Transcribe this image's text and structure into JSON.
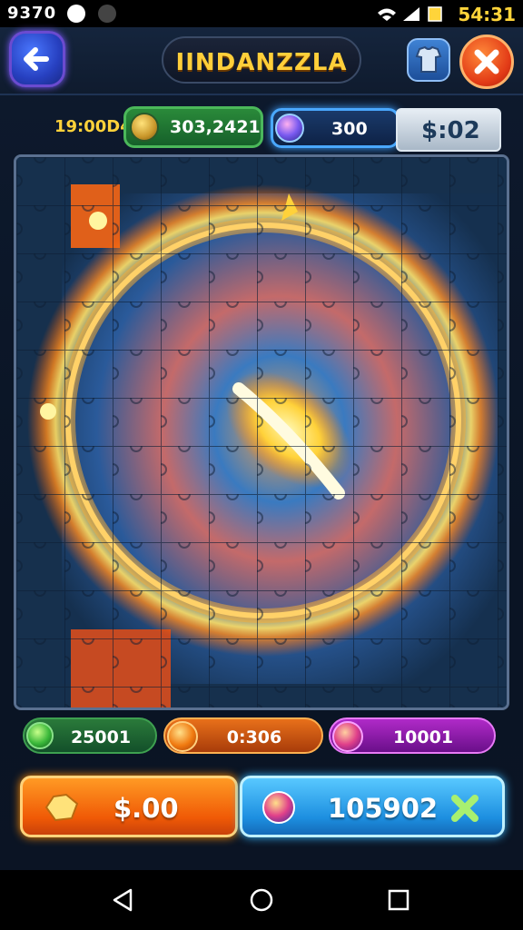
{
  "status_bar": {
    "left_text": "9370",
    "time": "54:31",
    "icons": [
      "wifi-icon",
      "signal-icon",
      "battery-icon"
    ]
  },
  "header": {
    "title": "IINDANZZLA",
    "back_icon": "arrow-left-icon",
    "shirt_icon": "shirt-icon",
    "close_icon": "close-icon"
  },
  "stats": {
    "time_label": "19:00D4",
    "coins": "303,2421",
    "gems": "300",
    "money": "$:02"
  },
  "counters": [
    {
      "icon": "green-gem-icon",
      "value": "25001"
    },
    {
      "icon": "fire-orb-icon",
      "value": "0:306"
    },
    {
      "icon": "purple-gem-icon",
      "value": "10001"
    }
  ],
  "actions": {
    "left_label": "$.00",
    "right_label": "105902"
  },
  "colors": {
    "accent_gold": "#ffcf3a",
    "orange": "#f05a06",
    "blue": "#1d8fe0",
    "board_blue": "#17304e"
  }
}
